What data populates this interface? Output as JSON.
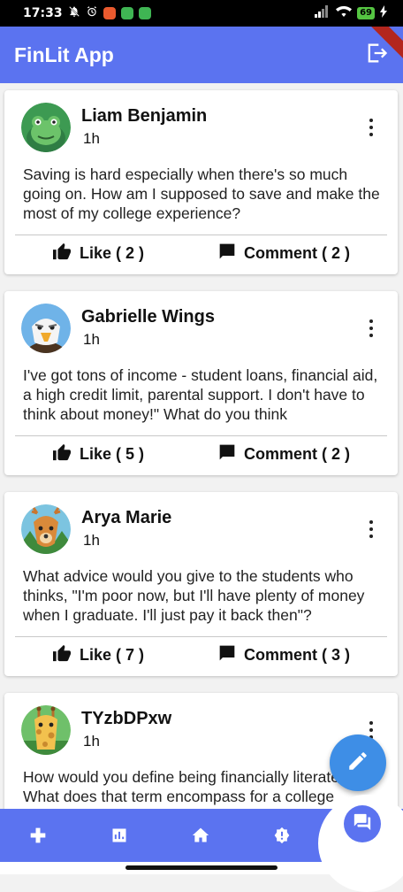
{
  "status_bar": {
    "time": "17:33",
    "battery": "69"
  },
  "app_bar": {
    "title": "FinLit App",
    "logout_icon": "logout-icon"
  },
  "posts": [
    {
      "author": "Liam Benjamin",
      "time": "1h",
      "text": "Saving is hard especially when there's so much going on. How am I supposed to save and make the most of my college experience?",
      "like_label": "Like ( 2 )",
      "comment_label": "Comment ( 2 )",
      "avatar": "frog-avatar"
    },
    {
      "author": "Gabrielle Wings",
      "time": "1h",
      "text": "I've got tons of income - student loans, financial aid, a high credit limit, parental support. I don't have to think about money!\" What do you think",
      "like_label": "Like ( 5 )",
      "comment_label": "Comment ( 2 )",
      "avatar": "eagle-avatar"
    },
    {
      "author": "Arya Marie",
      "time": "1h",
      "text": "What advice would you give to the students who thinks, \"I'm poor now, but I'll have plenty of money when I graduate. I'll just pay it back then\"?",
      "like_label": "Like ( 7 )",
      "comment_label": "Comment ( 3 )",
      "avatar": "deer-avatar"
    },
    {
      "author": "TYzbDPxw",
      "time": "1h",
      "text": "How would you define being financially literate? What does that term encompass for a college",
      "avatar": "giraffe-avatar"
    }
  ],
  "bottom_nav": {
    "items": [
      "games-icon",
      "chart-icon",
      "home-icon",
      "alert-badge-icon"
    ],
    "chat": "chat-icon"
  },
  "colors": {
    "primary": "#5b73f0",
    "fab": "#3e8ee6",
    "card": "#ffffff",
    "background": "#f2f2f2"
  }
}
